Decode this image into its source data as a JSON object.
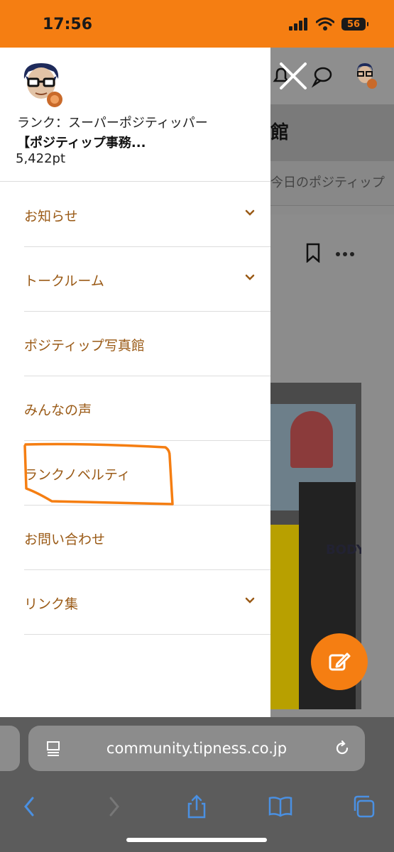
{
  "status_bar": {
    "time": "17:56",
    "battery": "56"
  },
  "background_page": {
    "title_fragment": "館",
    "tab_fragment": "今日のポジティップ",
    "photo_text": "BODY"
  },
  "drawer": {
    "rank": "ランク：スーパーポジティッパー",
    "username": "【ポジティップ事務...",
    "points": "5,422pt",
    "menu": [
      {
        "label": "お知らせ",
        "expandable": true
      },
      {
        "label": "トークルーム",
        "expandable": true
      },
      {
        "label": "ポジティップ写真館",
        "expandable": false
      },
      {
        "label": "みんなの声",
        "expandable": false
      },
      {
        "label": "ランクノベルティ",
        "expandable": false,
        "highlighted": true
      },
      {
        "label": "お問い合わせ",
        "expandable": false
      },
      {
        "label": "リンク集",
        "expandable": true
      }
    ]
  },
  "browser": {
    "url": "community.tipness.co.jp"
  },
  "colors": {
    "accent": "#f57e12",
    "menu_text": "#9a5a16",
    "highlight": "#f57e12"
  }
}
